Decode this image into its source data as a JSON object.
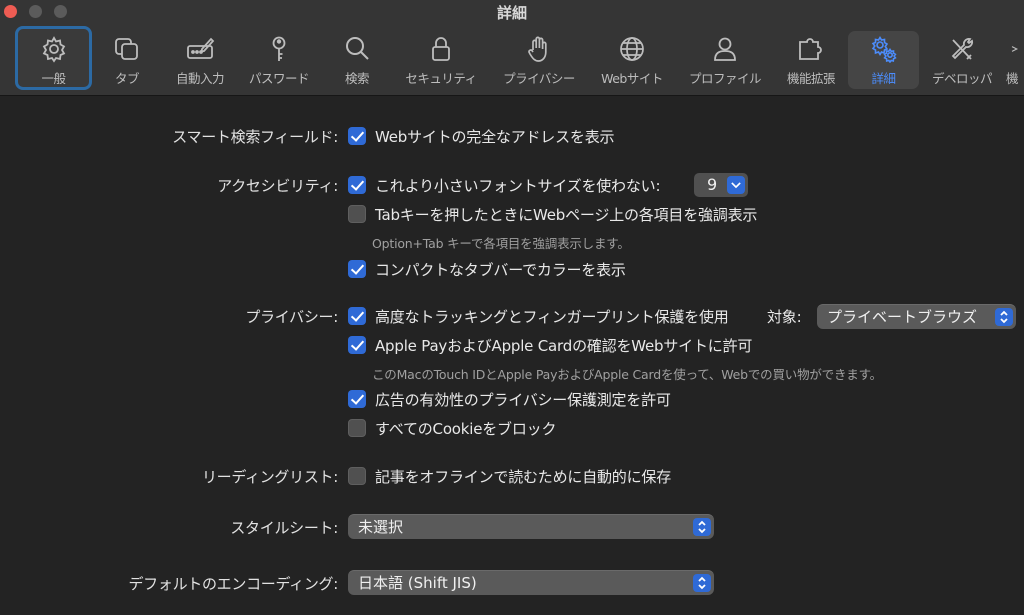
{
  "window": {
    "title": "詳細"
  },
  "toolbar": {
    "tabs": [
      {
        "label": "一般",
        "icon": "gear-icon"
      },
      {
        "label": "タブ",
        "icon": "tabs-icon"
      },
      {
        "label": "自動入力",
        "icon": "pencil-form-icon"
      },
      {
        "label": "パスワード",
        "icon": "key-icon"
      },
      {
        "label": "検索",
        "icon": "magnifier-icon"
      },
      {
        "label": "セキュリティ",
        "icon": "lock-icon"
      },
      {
        "label": "プライバシー",
        "icon": "hand-icon"
      },
      {
        "label": "Webサイト",
        "icon": "globe-icon"
      },
      {
        "label": "プロファイル",
        "icon": "person-icon"
      },
      {
        "label": "機能拡張",
        "icon": "puzzle-icon"
      },
      {
        "label": "詳細",
        "icon": "gears-icon"
      },
      {
        "label": "デベロッパ",
        "icon": "tools-icon"
      },
      {
        "label": "機",
        "icon": "overflow-icon"
      }
    ],
    "selected_tab": "詳細",
    "focused_tab": "一般"
  },
  "settings": {
    "smart_search": {
      "label": "スマート検索フィールド:",
      "options": [
        {
          "text": "Webサイトの完全なアドレスを表示",
          "checked": true
        }
      ]
    },
    "accessibility": {
      "label": "アクセシビリティ:",
      "min_font": {
        "text": "これより小さいフォントサイズを使わない:",
        "checked": true,
        "value": "9"
      },
      "tab_highlight": {
        "text": "Tabキーを押したときにWebページ上の各項目を強調表示",
        "checked": false
      },
      "tab_hint": "Option+Tab キーで各項目を強調表示します。",
      "compact_tab": {
        "text": "コンパクトなタブバーでカラーを表示",
        "checked": true
      }
    },
    "privacy": {
      "label": "プライバシー:",
      "tracking": {
        "text": "高度なトラッキングとフィンガープリント保護を使用",
        "checked": true
      },
      "target_label": "対象:",
      "target_value": "プライベートブラウズ",
      "apple_pay": {
        "text": "Apple PayおよびApple Cardの確認をWebサイトに許可",
        "checked": true
      },
      "apple_pay_hint": "このMacのTouch IDとApple PayおよびApple Cardを使って、Webでの買い物ができます。",
      "ad_measure": {
        "text": "広告の有効性のプライバシー保護測定を許可",
        "checked": true
      },
      "block_cookies": {
        "text": "すべてのCookieをブロック",
        "checked": false
      }
    },
    "reading_list": {
      "label": "リーディングリスト:",
      "offline": {
        "text": "記事をオフラインで読むために自動的に保存",
        "checked": false
      }
    },
    "stylesheet": {
      "label": "スタイルシート:",
      "value": "未選択"
    },
    "encoding": {
      "label": "デフォルトのエンコーディング:",
      "value": "日本語 (Shift JIS)"
    }
  },
  "colors": {
    "accent": "#2f6ad6",
    "selected_tab_text": "#4c8dfc",
    "focus_ring": "#2c6aa4",
    "background": "#232323",
    "toolbar": "#353535"
  }
}
